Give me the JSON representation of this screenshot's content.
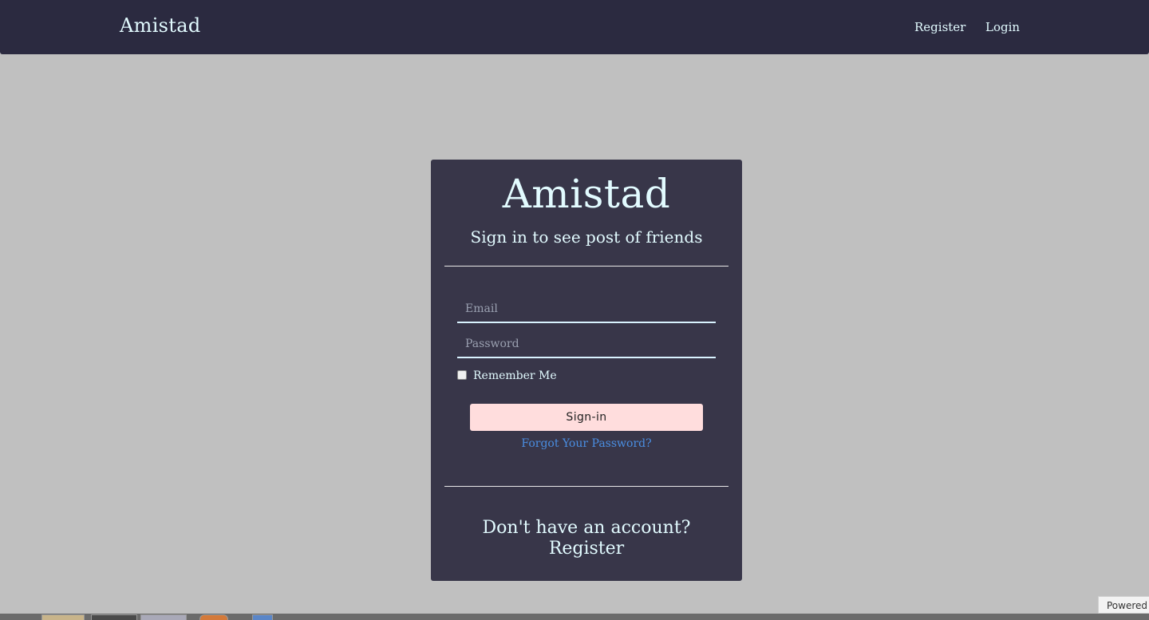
{
  "navbar": {
    "brand": "Amistad",
    "links": {
      "register": "Register",
      "login": "Login"
    },
    "colors": {
      "background": "#2b2a40",
      "text": "#e2fbff"
    }
  },
  "login_card": {
    "title": "Amistad",
    "subtitle": "Sign in to see post of friends",
    "email": {
      "placeholder": "Email",
      "value": ""
    },
    "password": {
      "placeholder": "Password",
      "value": ""
    },
    "remember_me": {
      "label": "Remember Me",
      "checked": false
    },
    "signin_label": "Sign-in",
    "forgot_label": "Forgot Your Password?",
    "no_account_label": "Don't have an account?",
    "register_label": "Register",
    "colors": {
      "background": "#383649",
      "button": "#ffdddd",
      "link": "#4a8ee2"
    }
  },
  "footer": {
    "powered_label": "Powered"
  },
  "page": {
    "background": "#c0c0c0"
  }
}
